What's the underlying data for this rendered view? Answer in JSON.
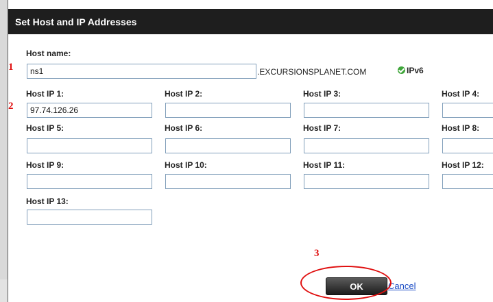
{
  "dialog": {
    "title": "Set Host and IP Addresses",
    "host_name_label": "Host name:",
    "host_name_value": "ns1",
    "domain_suffix": ".EXCURSIONSPLANET.COM",
    "ipv6_label": "IPv6",
    "ip_fields": [
      {
        "label": "Host IP 1:",
        "value": "97.74.126.26"
      },
      {
        "label": "Host IP 2:",
        "value": ""
      },
      {
        "label": "Host IP 3:",
        "value": ""
      },
      {
        "label": "Host IP 4:",
        "value": ""
      },
      {
        "label": "Host IP 5:",
        "value": ""
      },
      {
        "label": "Host IP 6:",
        "value": ""
      },
      {
        "label": "Host IP 7:",
        "value": ""
      },
      {
        "label": "Host IP 8:",
        "value": ""
      },
      {
        "label": "Host IP 9:",
        "value": ""
      },
      {
        "label": "Host IP 10:",
        "value": ""
      },
      {
        "label": "Host IP 11:",
        "value": ""
      },
      {
        "label": "Host IP 12:",
        "value": ""
      },
      {
        "label": "Host IP 13:",
        "value": ""
      }
    ],
    "ok_label": "OK",
    "cancel_label": "Cancel"
  },
  "annotations": {
    "step1": "1",
    "step2": "2",
    "step3": "3",
    "color": "#e01010"
  },
  "icons": {
    "ipv6": "check-circle-icon"
  },
  "colors": {
    "titlebar": "#1e1e1e",
    "ipv6_check": "#3fa63a",
    "cancel_link": "#1a4bc4"
  }
}
